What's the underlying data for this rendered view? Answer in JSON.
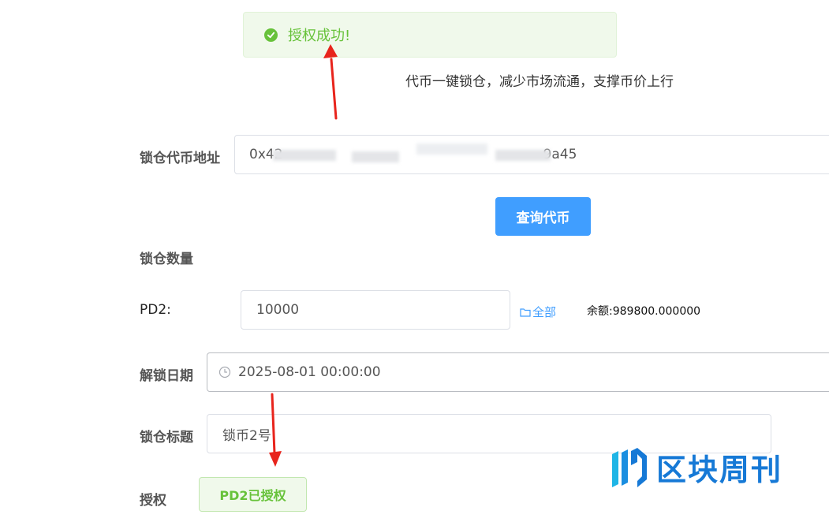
{
  "toast": {
    "message": "授权成功!",
    "icon": "check-circle-icon",
    "color": "#67c23a"
  },
  "subtitle": "代币一键锁仓，减少市场流通，支撑币价上行",
  "form": {
    "token_address": {
      "label": "锁仓代币地址",
      "value_start": "0x42",
      "value_end": "9a45"
    },
    "query_button": "查询代币",
    "amount": {
      "label": "锁仓数量",
      "token_label": "PD2:",
      "value": "10000",
      "all_link": "全部",
      "balance": "余额:989800.000000"
    },
    "unlock_date": {
      "label": "解锁日期",
      "value": "2025-08-01 00:00:00",
      "icon": "clock-icon"
    },
    "lock_title": {
      "label": "锁仓标题",
      "value": "锁币2号"
    },
    "authorize": {
      "label": "授权",
      "button": "PD2已授权"
    }
  },
  "watermark": {
    "text": "区块周刊",
    "logo": "qukuai-logo"
  },
  "colors": {
    "primary": "#409eff",
    "success": "#67c23a",
    "arrow": "#e8241c"
  }
}
